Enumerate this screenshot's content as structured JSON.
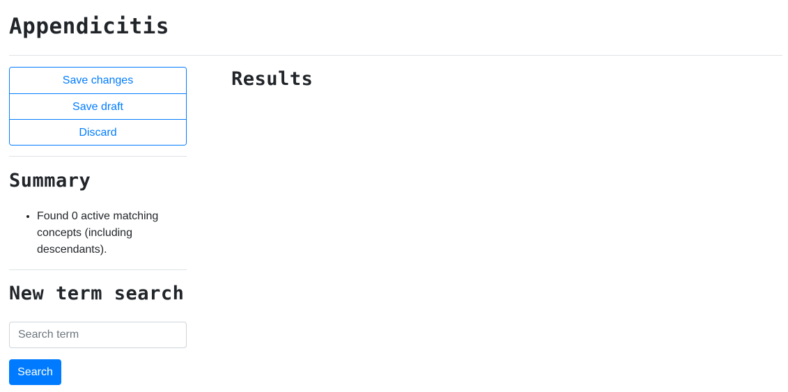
{
  "page": {
    "title": "Appendicitis"
  },
  "actions": {
    "save_changes": "Save changes",
    "save_draft": "Save draft",
    "discard": "Discard"
  },
  "summary": {
    "title": "Summary",
    "items": [
      "Found 0 active matching concepts (including descendants)."
    ]
  },
  "new_search": {
    "title": "New term search",
    "placeholder": "Search term",
    "value": "",
    "button_label": "Search"
  },
  "results": {
    "title": "Results"
  },
  "colors": {
    "accent": "#007bff",
    "text": "#212529",
    "divider": "#dee2e6"
  }
}
